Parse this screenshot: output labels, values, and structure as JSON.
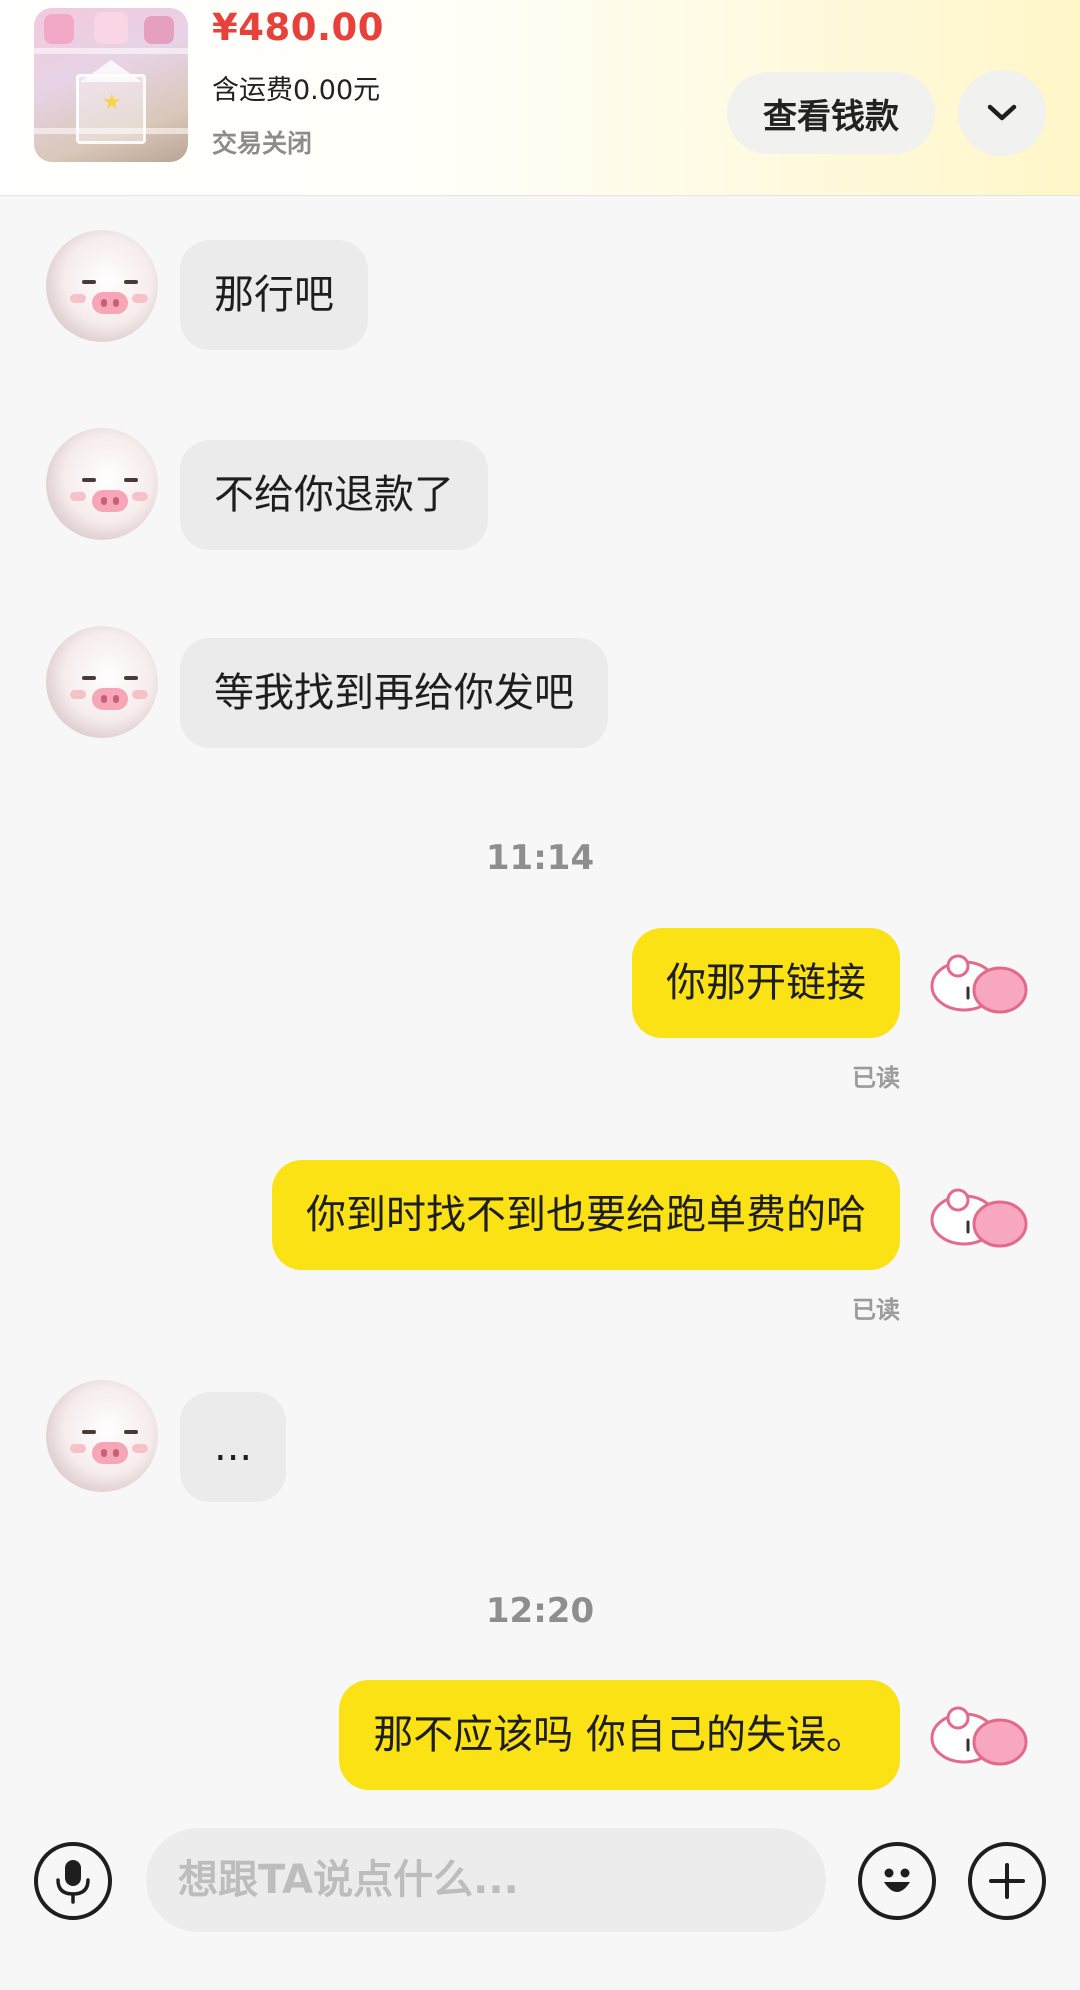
{
  "order": {
    "price": "¥480.00",
    "shipping": "含运费0.00元",
    "status": "交易关闭",
    "view_payment_label": "查看钱款",
    "expand_icon": "chevron-down-icon"
  },
  "messages": [
    {
      "from": "seller",
      "text": "那行吧"
    },
    {
      "from": "seller",
      "text": "不给你退款了"
    },
    {
      "from": "seller",
      "text": "等我找到再给你发吧"
    },
    {
      "type": "time",
      "text": "11:14"
    },
    {
      "from": "me",
      "text": "你那开链接",
      "status": "已读"
    },
    {
      "from": "me",
      "text": "你到时找不到也要给跑单费的哈",
      "status": "已读"
    },
    {
      "from": "seller",
      "text": "..."
    },
    {
      "type": "time",
      "text": "12:20"
    },
    {
      "from": "me",
      "text": "那不应该吗 你自己的失误。"
    }
  ],
  "input": {
    "placeholder": "想跟TA说点什么...",
    "value": "",
    "voice_icon": "microphone-icon",
    "emoji_icon": "emoji-icon",
    "plus_icon": "plus-icon"
  },
  "colors": {
    "price": "#e8413b",
    "outgoing_bubble": "#fbe214",
    "incoming_bubble": "#ebebeb",
    "background": "#f7f7f7"
  }
}
